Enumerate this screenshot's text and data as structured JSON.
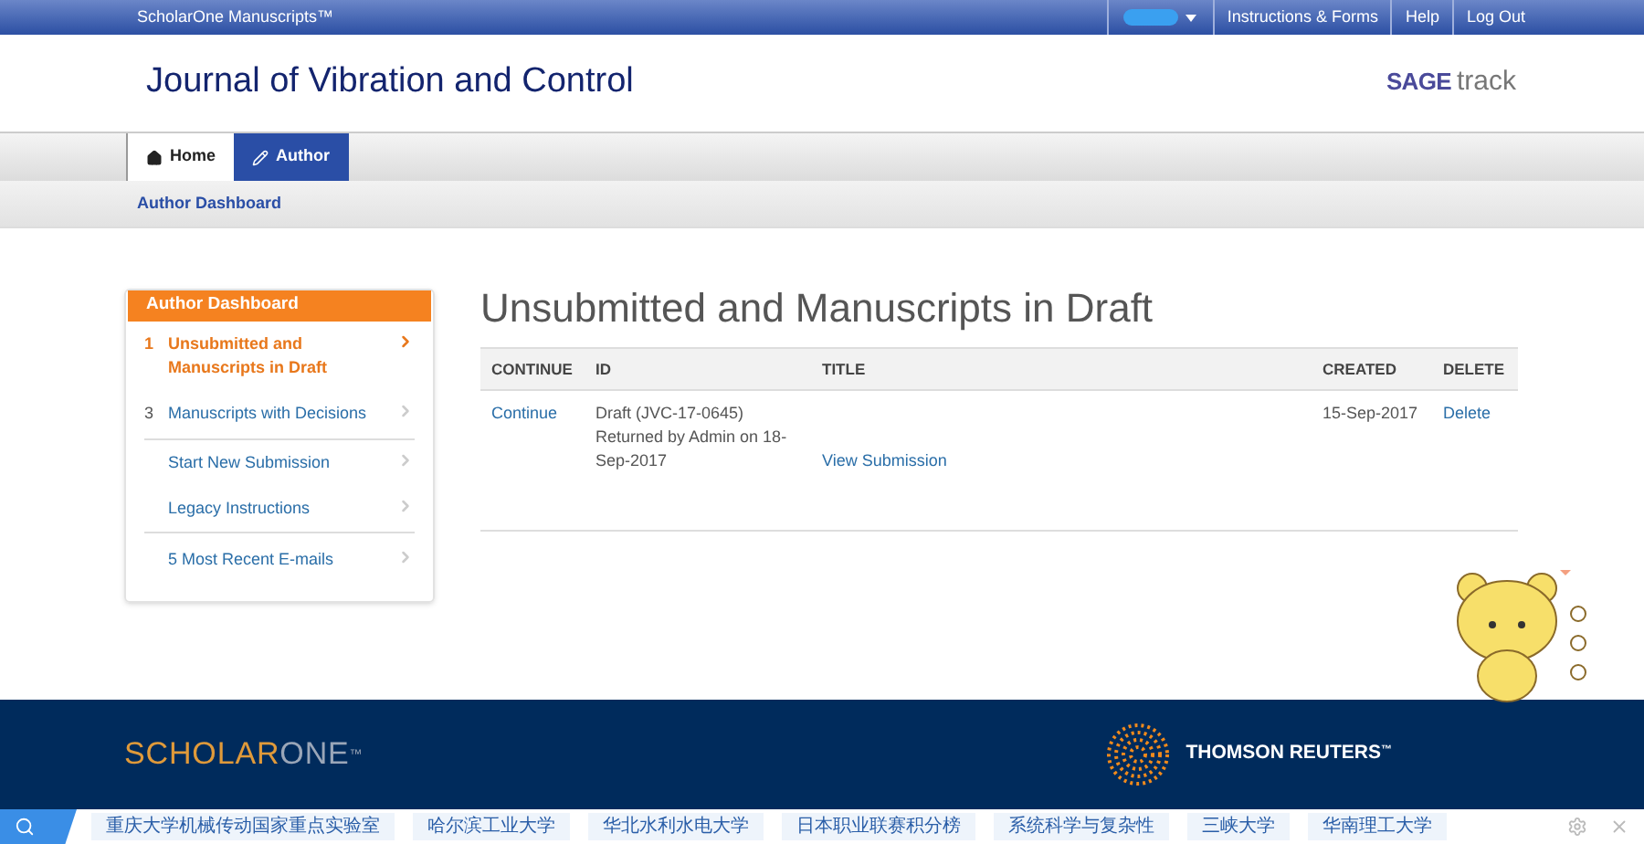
{
  "top_bar": {
    "brand": "ScholarOne Manuscripts™",
    "links": [
      "Instructions & Forms",
      "Help",
      "Log Out"
    ]
  },
  "header": {
    "title": "Journal of Vibration and Control",
    "logo": "SAGE",
    "logo_suffix": "track"
  },
  "nav_tabs": [
    {
      "label": "Home",
      "kind": "home",
      "selected": false
    },
    {
      "label": "Author",
      "kind": "author",
      "selected": true
    }
  ],
  "breadcrumb": "Author Dashboard",
  "sidebar": {
    "title": "Author Dashboard",
    "items": [
      {
        "count": "1",
        "label": "Unsubmitted and Manuscripts in Draft",
        "selected": true
      },
      {
        "count": "3",
        "label": "Manuscripts with Decisions",
        "selected": false
      },
      {
        "label": "Start New Submission",
        "selected": false
      },
      {
        "label": "Legacy Instructions",
        "selected": false
      },
      {
        "label": "5 Most Recent E-mails",
        "selected": false
      }
    ]
  },
  "main": {
    "heading": "Unsubmitted and Manuscripts in Draft",
    "table": {
      "columns": [
        "CONTINUE",
        "ID",
        "TITLE",
        "CREATED",
        "DELETE"
      ],
      "rows": [
        {
          "continue": "Continue",
          "id": "Draft (JVC-17-0645) Returned by Admin on 18-Sep-2017",
          "title_link": "View Submission",
          "created": "15-Sep-2017",
          "delete": "Delete"
        }
      ]
    }
  },
  "footer": {
    "brand_a": "SCHOLAR",
    "brand_b": "ONE",
    "brand_tm": "™",
    "partner": "THOMSON REUTERS",
    "partner_tm": "™"
  },
  "bookmarks": [
    "重庆大学机械传动国家重点实验室",
    "哈尔滨工业大学",
    "华北水利水电大学",
    "日本职业联赛积分榜",
    "系统科学与复杂性",
    "三峡大学",
    "华南理工大学"
  ]
}
